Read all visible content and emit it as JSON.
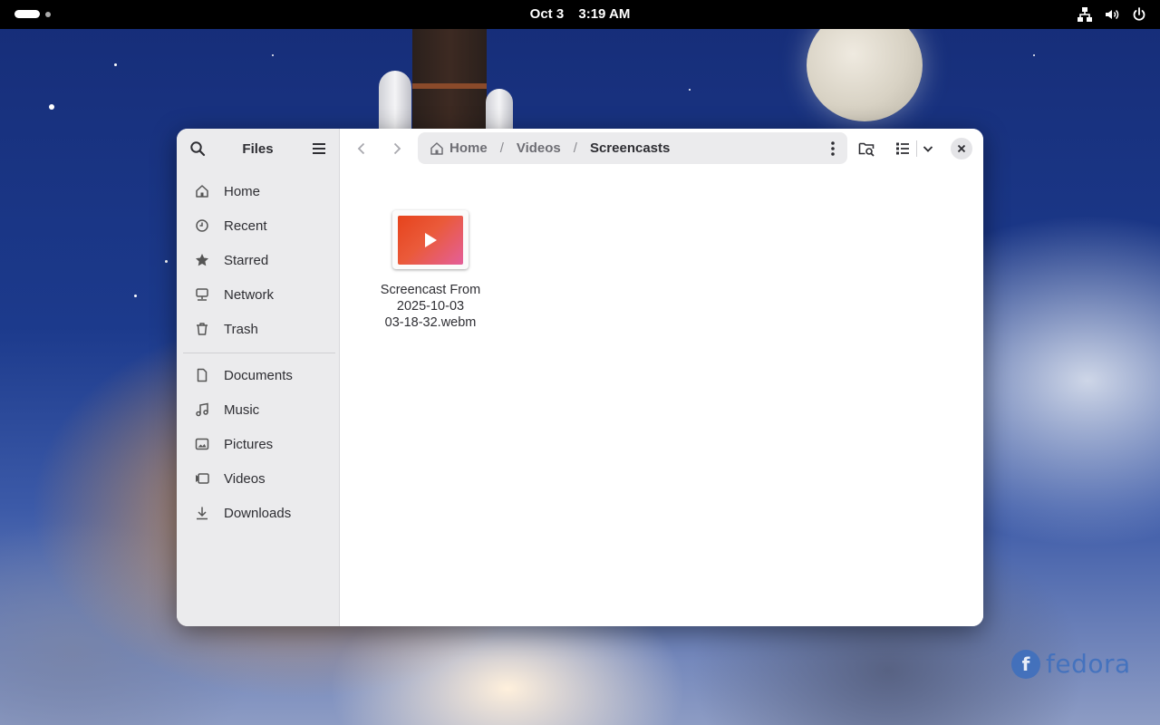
{
  "topbar": {
    "date": "Oct 3",
    "time": "3:19 AM",
    "icons": [
      "network-icon",
      "volume-icon",
      "power-icon"
    ]
  },
  "window": {
    "sidebar": {
      "title": "Files",
      "places": [
        {
          "label": "Home",
          "icon": "home-icon"
        },
        {
          "label": "Recent",
          "icon": "clock-icon"
        },
        {
          "label": "Starred",
          "icon": "star-icon"
        },
        {
          "label": "Network",
          "icon": "network-icon"
        },
        {
          "label": "Trash",
          "icon": "trash-icon"
        }
      ],
      "bookmarks": [
        {
          "label": "Documents",
          "icon": "document-icon"
        },
        {
          "label": "Music",
          "icon": "music-icon"
        },
        {
          "label": "Pictures",
          "icon": "picture-icon"
        },
        {
          "label": "Videos",
          "icon": "video-icon"
        },
        {
          "label": "Downloads",
          "icon": "download-icon"
        }
      ]
    },
    "pathbar": {
      "crumbs": [
        "Home",
        "Videos",
        "Screencasts"
      ],
      "separator": "/"
    },
    "files": [
      {
        "name_lines": [
          "Screencast From",
          "2025-10-03",
          "03-18-32.webm"
        ],
        "type": "video"
      }
    ]
  },
  "desktop": {
    "logo_text": "fedora"
  }
}
